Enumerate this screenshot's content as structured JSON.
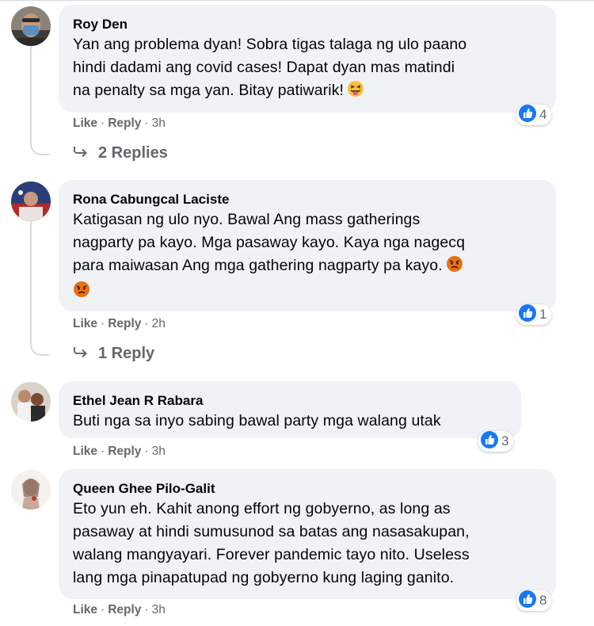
{
  "comments": [
    {
      "author": "Roy Den",
      "lines": [
        "Yan ang problema dyan! Sobra tigas talaga ng ulo paano",
        "hindi dadami ang covid cases! Dapat dyan mas matindi",
        "na penalty sa mga yan. Bitay patiwarik!"
      ],
      "reaction_count": "4",
      "like": "Like",
      "reply": "Reply",
      "time": "3h",
      "replies_label": "2 Replies"
    },
    {
      "author": "Rona Cabungcal Laciste",
      "lines": [
        "Katigasan ng ulo nyo. Bawal Ang mass gatherings",
        "nagparty pa kayo. Mga pasaway kayo. Kaya nga nagecq",
        "para maiwasan Ang mga gathering nagparty pa kayo."
      ],
      "reaction_count": "1",
      "like": "Like",
      "reply": "Reply",
      "time": "2h",
      "replies_label": "1 Reply"
    },
    {
      "author": "Ethel Jean R Rabara",
      "lines": [
        "Buti nga sa inyo sabing bawal party mga walang utak"
      ],
      "reaction_count": "3",
      "like": "Like",
      "reply": "Reply",
      "time": "3h"
    },
    {
      "author": "Queen Ghee Pilo-Galit",
      "lines": [
        "Eto yun eh. Kahit anong effort ng gobyerno, as long as",
        "pasaway at hindi sumusunod sa batas ang nasasakupan,",
        "walang mangyayari. Forever pandemic tayo nito. Useless",
        "lang mga pinapatupad ng gobyerno kung laging ganito."
      ],
      "reaction_count": "8",
      "like": "Like",
      "reply": "Reply",
      "time": "3h"
    }
  ],
  "colors": {
    "bubble": "#f0f2f5",
    "meta": "#65676b",
    "like_blue": "#1877f2",
    "angry": "#e9710f"
  },
  "icons": {
    "like": "thumbs-up-icon",
    "reply_arrow": "reply-arrow-icon",
    "tongue": "squinting-tongue-emoji",
    "angry": "angry-face-emoji"
  }
}
